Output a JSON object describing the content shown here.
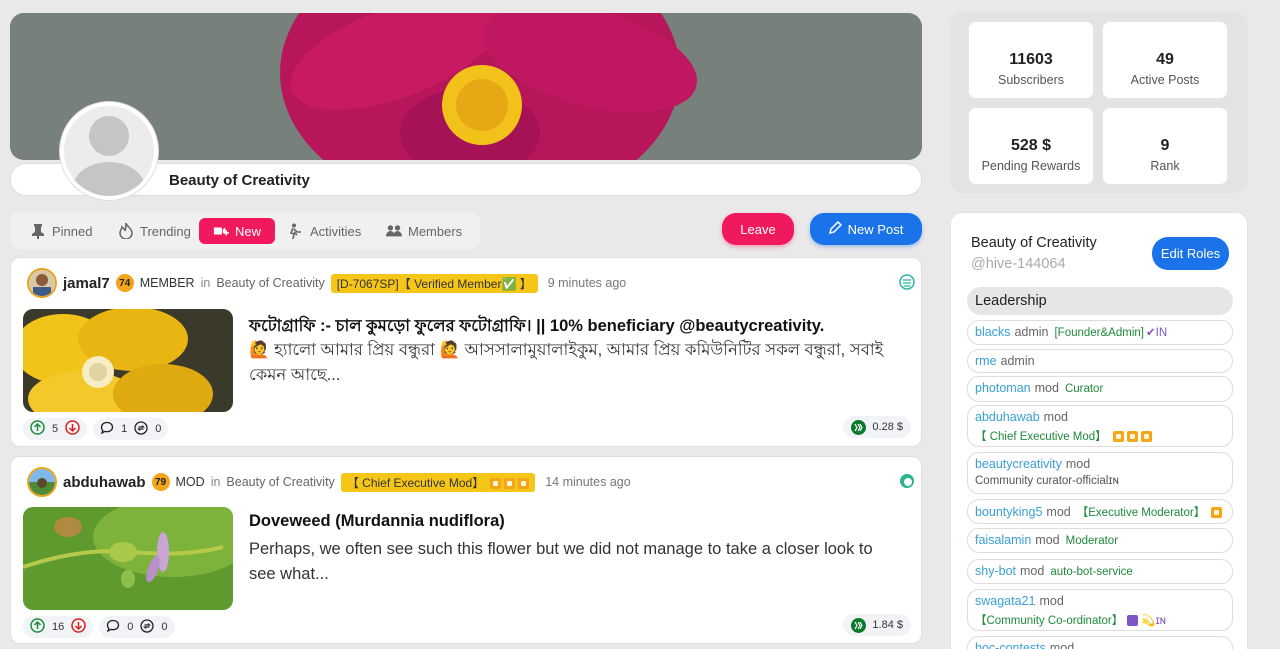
{
  "community": {
    "name": "Beauty of Creativity",
    "handle": "@hive-144064"
  },
  "tabs": [
    {
      "label": "Pinned",
      "icon": "pin-icon"
    },
    {
      "label": "Trending",
      "icon": "flame-icon"
    },
    {
      "label": "New",
      "icon": "new-icon",
      "active": true
    },
    {
      "label": "Activities",
      "icon": "activity-icon"
    },
    {
      "label": "Members",
      "icon": "members-icon"
    }
  ],
  "actions": {
    "leave": "Leave",
    "new_post": "New Post"
  },
  "posts": [
    {
      "author": "jamal7",
      "reputation": "74",
      "role": "MEMBER",
      "in": "in",
      "community": "Beauty of Creativity",
      "badge": "[D-7067SP]【 Verified Member✅ 】",
      "time": "9 minutes ago",
      "title": "ফটোগ্রাফি :- চাল কুমড়ো ফুলের ফটোগ্রাফি। || 10% beneficiary @beautycreativity.",
      "body": "🙋 হ্যালো আমার প্রিয় বন্ধুরা 🙋 আসসালামুয়ালাইকুম, আমার প্রিয় কমিউনিটির সকল বন্ধুরা, সবাই কেমন আছে...",
      "upvotes": "5",
      "comments": "1",
      "reblogs": "0",
      "payout": "0.28 $"
    },
    {
      "author": "abduhawab",
      "reputation": "79",
      "role": "MOD",
      "in": "in",
      "community": "Beauty of Creativity",
      "badge": "【 Chief Executive Mod】",
      "time": "14 minutes ago",
      "title": "Doveweed (Murdannia nudiflora)",
      "body": "Perhaps, we often see such this flower but we did not manage to take a closer look to see what...",
      "upvotes": "16",
      "comments": "0",
      "reblogs": "0",
      "payout": "1.84 $"
    }
  ],
  "stats": [
    {
      "value": "11603",
      "label": "Subscribers"
    },
    {
      "value": "49",
      "label": "Active Posts"
    },
    {
      "value": "528 $",
      "label": "Pending Rewards"
    },
    {
      "value": "9",
      "label": "Rank"
    }
  ],
  "sidebar": {
    "edit_roles": "Edit Roles",
    "leadership_heading": "Leadership",
    "members": [
      {
        "name": "blacks",
        "role": "admin",
        "title": "[Founder&Admin]",
        "suffix": "✔IN"
      },
      {
        "name": "rme",
        "role": "admin",
        "title": ""
      },
      {
        "name": "photoman",
        "role": "mod",
        "title": "Curator"
      },
      {
        "name": "abduhawab",
        "role": "mod",
        "title": "【 Chief Executive Mod】"
      },
      {
        "name": "beautycreativity",
        "role": "mod",
        "title": "Community curator-officialɪɴ"
      },
      {
        "name": "bountyking5",
        "role": "mod",
        "title": "【Executive Moderator】"
      },
      {
        "name": "faisalamin",
        "role": "mod",
        "title": "Moderator"
      },
      {
        "name": "shy-bot",
        "role": "mod",
        "title": "auto-bot-service"
      },
      {
        "name": "swagata21",
        "role": "mod",
        "title": "【Community Co-ordinator】",
        "suffix": "💫ɪɴ"
      },
      {
        "name": "boc-contests",
        "role": "mod",
        "title": ""
      }
    ]
  },
  "colors": {
    "accent_pink": "#f0195d",
    "accent_blue": "#1a73e8",
    "link": "#3aa0d6",
    "badge": "#f5c518"
  }
}
